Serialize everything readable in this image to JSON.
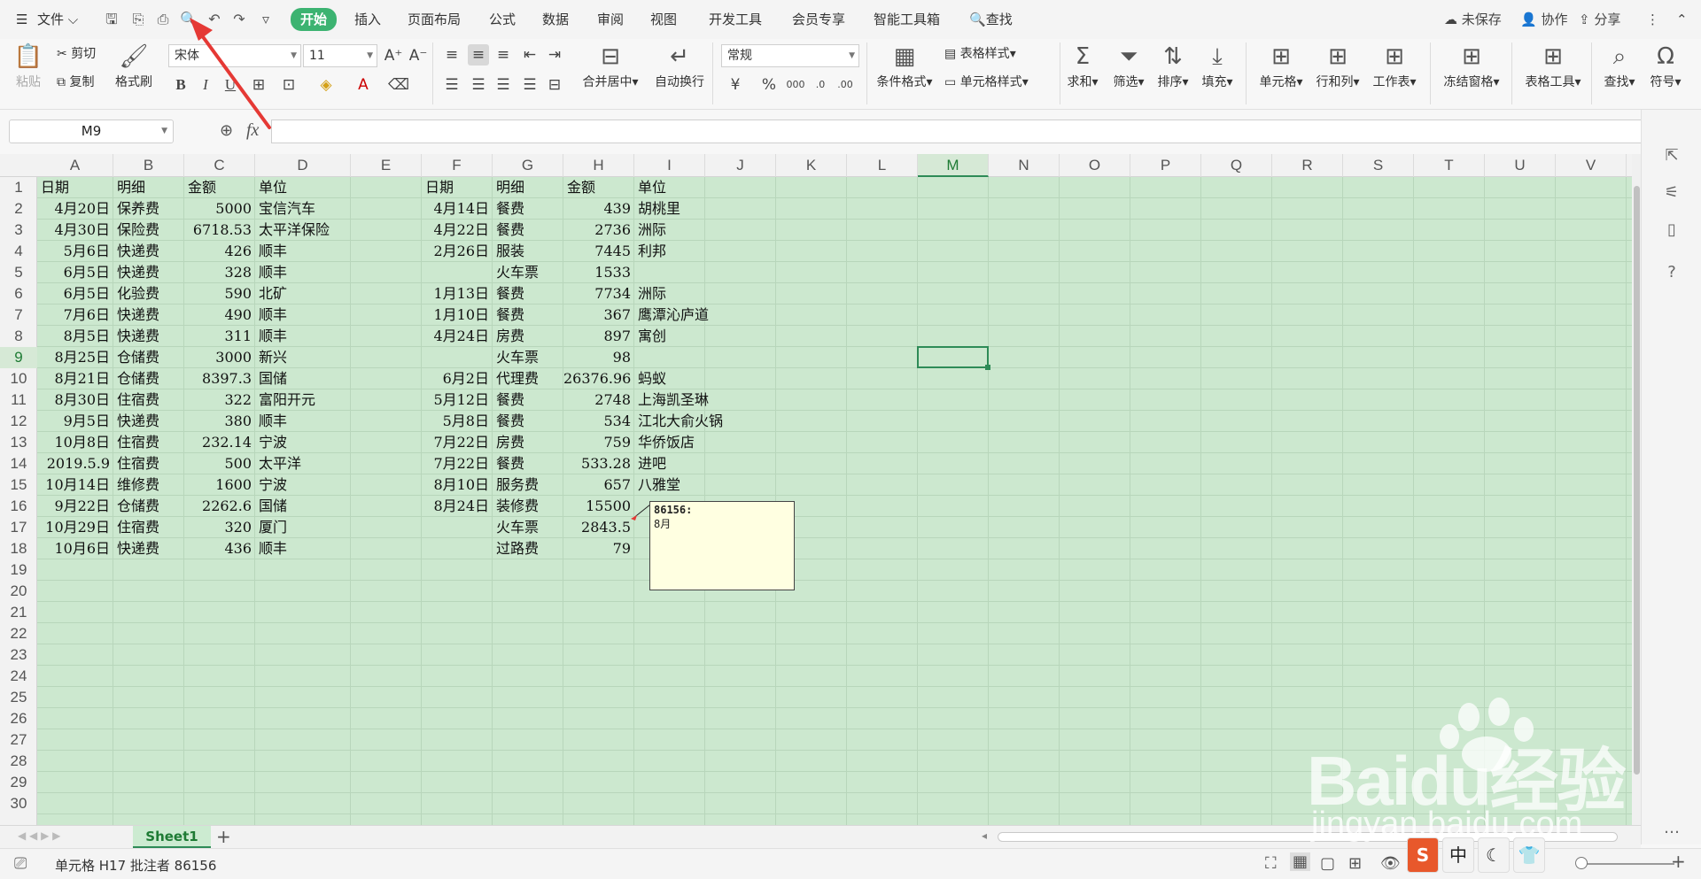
{
  "menubar": {
    "file_label": "文件",
    "tabs": [
      "开始",
      "插入",
      "页面布局",
      "公式",
      "数据",
      "审阅",
      "视图",
      "开发工具",
      "会员专享",
      "智能工具箱"
    ],
    "search_label": "查找",
    "unsaved_label": "未保存",
    "collab_label": "协作",
    "share_label": "分享"
  },
  "ribbon": {
    "paste": "粘贴",
    "cut": "剪切",
    "copy": "复制",
    "format_painter": "格式刷",
    "font_name": "宋体",
    "font_size": "11",
    "merge_center": "合并居中",
    "wrap_text": "自动换行",
    "number_format": "常规",
    "cond_format": "条件格式",
    "table_style": "表格样式",
    "cell_style": "单元格样式",
    "sum": "求和",
    "filter": "筛选",
    "sort": "排序",
    "fill": "填充",
    "cells": "单元格",
    "rows_cols": "行和列",
    "worksheet": "工作表",
    "freeze": "冻结窗格",
    "table_tools": "表格工具",
    "find": "查找",
    "symbol": "符号"
  },
  "formula_bar": {
    "name_box": "M9",
    "fx": "fx",
    "value": ""
  },
  "columns": [
    "A",
    "B",
    "C",
    "D",
    "E",
    "F",
    "G",
    "H",
    "I",
    "J",
    "K",
    "L",
    "M",
    "N",
    "O",
    "P",
    "Q",
    "R",
    "S",
    "T",
    "U",
    "V"
  ],
  "rows": [
    "1",
    "2",
    "3",
    "4",
    "5",
    "6",
    "7",
    "8",
    "9",
    "10",
    "11",
    "12",
    "13",
    "14",
    "15",
    "16",
    "17",
    "18",
    "19",
    "20",
    "21",
    "22",
    "23",
    "24",
    "25",
    "26",
    "27",
    "28",
    "29",
    "30"
  ],
  "table_left": {
    "headers": [
      "日期",
      "明细",
      "金额",
      "单位"
    ],
    "rows": [
      [
        "4月20日",
        "保养费",
        "5000",
        "宝信汽车"
      ],
      [
        "4月30日",
        "保险费",
        "6718.53",
        "太平洋保险"
      ],
      [
        "5月6日",
        "快递费",
        "426",
        "顺丰"
      ],
      [
        "6月5日",
        "快递费",
        "328",
        "顺丰"
      ],
      [
        "6月5日",
        "化验费",
        "590",
        "北矿"
      ],
      [
        "7月6日",
        "快递费",
        "490",
        "顺丰"
      ],
      [
        "8月5日",
        "快递费",
        "311",
        "顺丰"
      ],
      [
        "8月25日",
        "仓储费",
        "3000",
        "新兴"
      ],
      [
        "8月21日",
        "仓储费",
        "8397.3",
        "国储"
      ],
      [
        "8月30日",
        "住宿费",
        "322",
        "富阳开元"
      ],
      [
        "9月5日",
        "快递费",
        "380",
        "顺丰"
      ],
      [
        "10月8日",
        "住宿费",
        "232.14",
        "宁波"
      ],
      [
        "2019.5.9",
        "住宿费",
        "500",
        "太平洋"
      ],
      [
        "10月14日",
        "维修费",
        "1600",
        "宁波"
      ],
      [
        "9月22日",
        "仓储费",
        "2262.6",
        "国储"
      ],
      [
        "10月29日",
        "住宿费",
        "320",
        "厦门"
      ],
      [
        "10月6日",
        "快递费",
        "436",
        "顺丰"
      ]
    ]
  },
  "table_right": {
    "headers": [
      "日期",
      "明细",
      "金额",
      "单位"
    ],
    "rows": [
      [
        "4月14日",
        "餐费",
        "439",
        "胡桃里"
      ],
      [
        "4月22日",
        "餐费",
        "2736",
        "洲际"
      ],
      [
        "2月26日",
        "服装",
        "7445",
        "利邦"
      ],
      [
        "",
        "火车票",
        "1533",
        ""
      ],
      [
        "1月13日",
        "餐费",
        "7734",
        "洲际"
      ],
      [
        "1月10日",
        "餐费",
        "367",
        "鹰潭沁庐道"
      ],
      [
        "4月24日",
        "房费",
        "897",
        "寓创"
      ],
      [
        "",
        "火车票",
        "98",
        ""
      ],
      [
        "6月2日",
        "代理费",
        "26376.96",
        "蚂蚁"
      ],
      [
        "5月12日",
        "餐费",
        "2748",
        "上海凯圣琳"
      ],
      [
        "5月8日",
        "餐费",
        "534",
        "江北大俞火锅"
      ],
      [
        "7月22日",
        "房费",
        "759",
        "华侨饭店"
      ],
      [
        "7月22日",
        "餐费",
        "533.28",
        "进吧"
      ],
      [
        "8月10日",
        "服务费",
        "657",
        "八雅堂"
      ],
      [
        "8月24日",
        "装修费",
        "15500",
        ""
      ],
      [
        "",
        "火车票",
        "2843.5",
        ""
      ],
      [
        "",
        "过路费",
        "79",
        ""
      ]
    ]
  },
  "comment": {
    "author": "86156:",
    "text": "8月"
  },
  "sheet_tab": "Sheet1",
  "status": {
    "text": "单元格 H17 批注者 86156"
  },
  "watermark": {
    "brand": "Baidu经验",
    "url": "jingyan.baidu.com"
  },
  "ime": [
    "S",
    "中",
    "☾",
    "👕"
  ],
  "colors": {
    "accent": "#3cb371",
    "grid_bg": "#cce8cf",
    "comment_bg": "#ffffe1",
    "arrow": "#e53935"
  }
}
